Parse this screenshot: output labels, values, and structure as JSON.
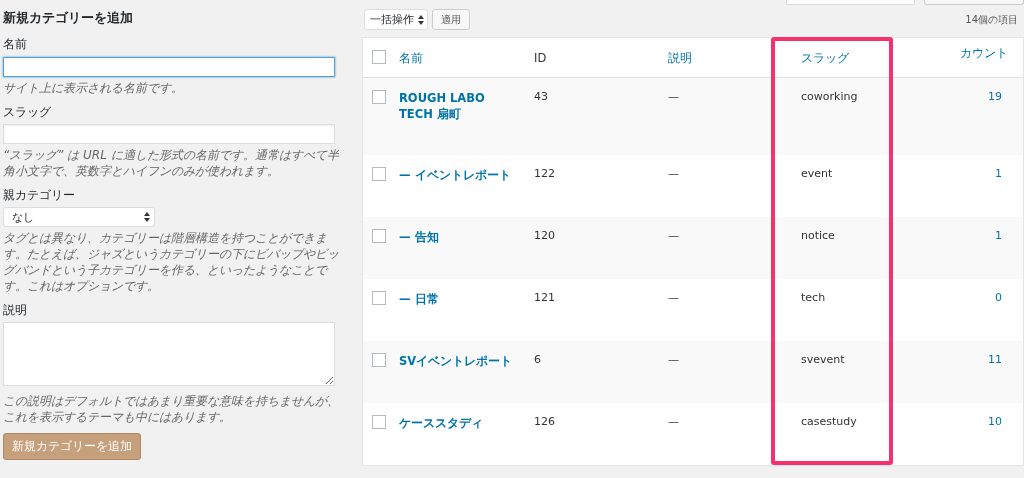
{
  "form": {
    "title": "新規カテゴリーを追加",
    "fields": [
      {
        "kind": "text",
        "label": "名前",
        "focused": true,
        "hint": "サイト上に表示される名前です。"
      },
      {
        "kind": "text",
        "label": "スラッグ",
        "focused": false,
        "hint": "“スラッグ” は URL に適した形式の名前です。通常はすべて半角小文字で、英数字とハイフンのみが使われます。"
      },
      {
        "kind": "select",
        "label": "親カテゴリー",
        "value": "なし",
        "hint": "タグとは異なり、カテゴリーは階層構造を持つことができます。たとえば、ジャズというカテゴリーの下にビバップやビッグバンドという子カテゴリーを作る、といったようなことです。これはオプションです。"
      },
      {
        "kind": "textarea",
        "label": "説明",
        "hint": "この説明はデフォルトではあまり重要な意味を持ちませんが、これを表示するテーマも中にはあります。"
      }
    ],
    "submit": "新規カテゴリーを追加"
  },
  "toolbar": {
    "bulk_action": "一括操作",
    "apply": "適用",
    "item_count": "14個の項目"
  },
  "table": {
    "select_all_checked": false,
    "columns": [
      {
        "label": "名前",
        "link": true
      },
      {
        "label": "ID",
        "link": false
      },
      {
        "label": "説明",
        "link": true
      },
      {
        "label": "スラッグ",
        "link": true
      },
      {
        "label": "カウント",
        "link": true
      }
    ],
    "annotations": [
      {
        "kind": "highlight-frame"
      }
    ],
    "rows": [
      {
        "name": "ROUGH LABO TECH 扇町",
        "id": "43",
        "description": "—",
        "slug": "coworking",
        "count": "19",
        "checked": false
      },
      {
        "name": "— イベントレポート",
        "id": "122",
        "description": "—",
        "slug": "event",
        "count": "1",
        "checked": false
      },
      {
        "name": "— 告知",
        "id": "120",
        "description": "—",
        "slug": "notice",
        "count": "1",
        "checked": false
      },
      {
        "name": "— 日常",
        "id": "121",
        "description": "—",
        "slug": "tech",
        "count": "0",
        "checked": false
      },
      {
        "name": "SVイベントレポート",
        "id": "6",
        "description": "—",
        "slug": "svevent",
        "count": "11",
        "checked": false
      },
      {
        "name": "ケーススタディ",
        "id": "126",
        "description": "—",
        "slug": "casestudy",
        "count": "10",
        "checked": false
      }
    ]
  }
}
